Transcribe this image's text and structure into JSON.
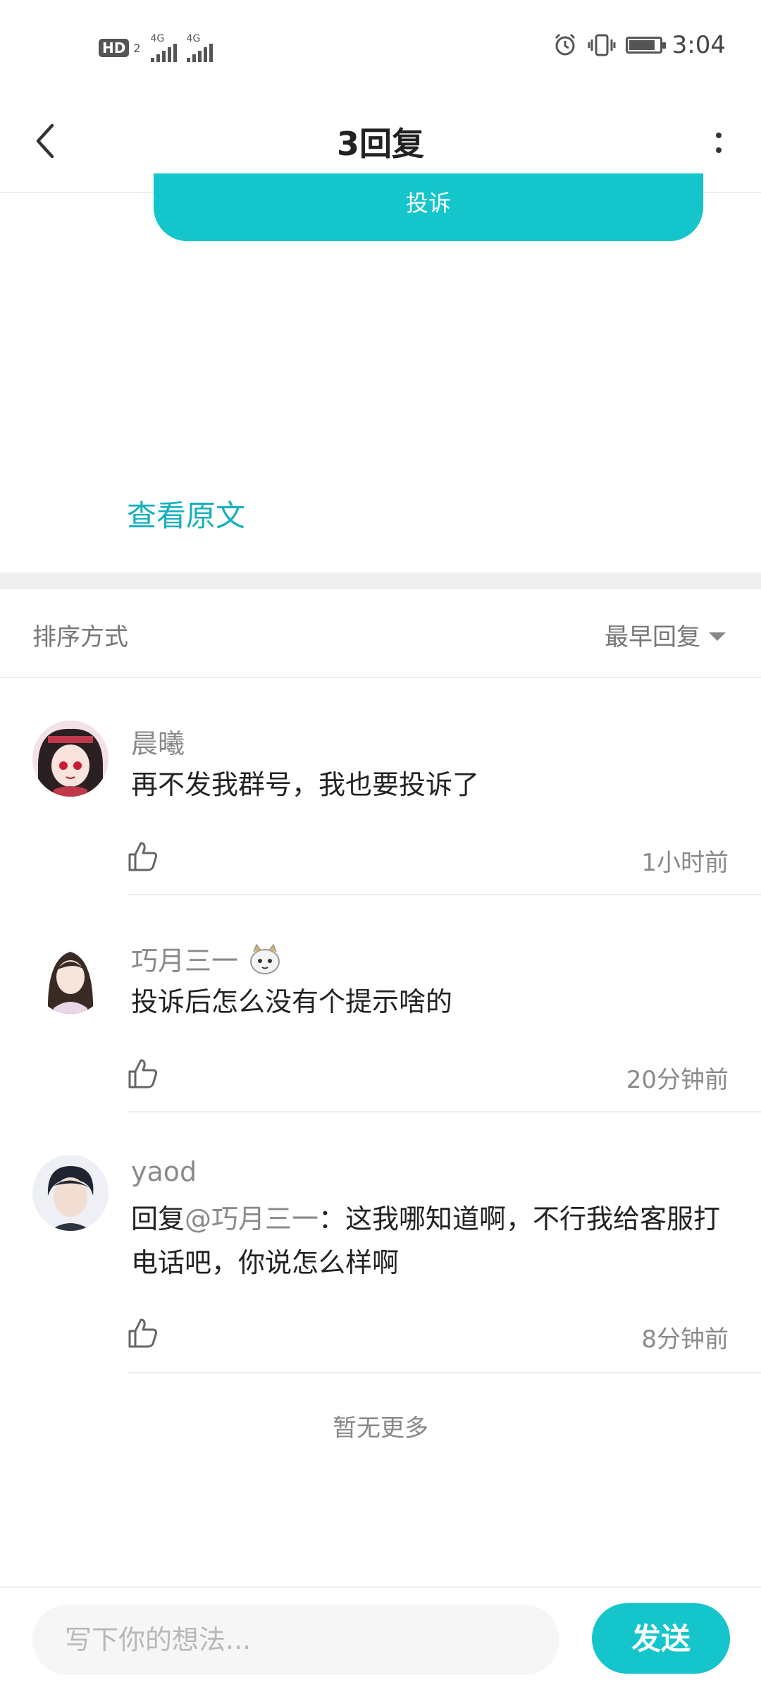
{
  "status_bar": {
    "hd_label": "HD",
    "sim_label": "2",
    "network_1": "4G",
    "network_2": "4G",
    "time": "3:04",
    "battery_level": 0.88
  },
  "header": {
    "title": "3回复"
  },
  "post": {
    "complain_label": "投诉",
    "view_original_label": "查看原文"
  },
  "sort": {
    "label": "排序方式",
    "selected": "最早回复"
  },
  "comments": [
    {
      "username": "晨曦",
      "text": "再不发我群号，我也要投诉了",
      "time": "1小时前"
    },
    {
      "username": "巧月三一",
      "text": "投诉后怎么没有个提示啥的",
      "time": "20分钟前"
    },
    {
      "username": "yaod",
      "reply_prefix": "回复",
      "mention": "@巧月三一",
      "text": "：这我哪知道啊，不行我给客服打电话吧，你说怎么样啊",
      "time": "8分钟前"
    }
  ],
  "footer": {
    "no_more": "暂无更多"
  },
  "bottom_bar": {
    "input_placeholder": "写下你的想法...",
    "send_label": "发送"
  },
  "colors": {
    "accent": "#14c5cb",
    "link": "#14b1bb",
    "muted": "#8a8a8a"
  }
}
